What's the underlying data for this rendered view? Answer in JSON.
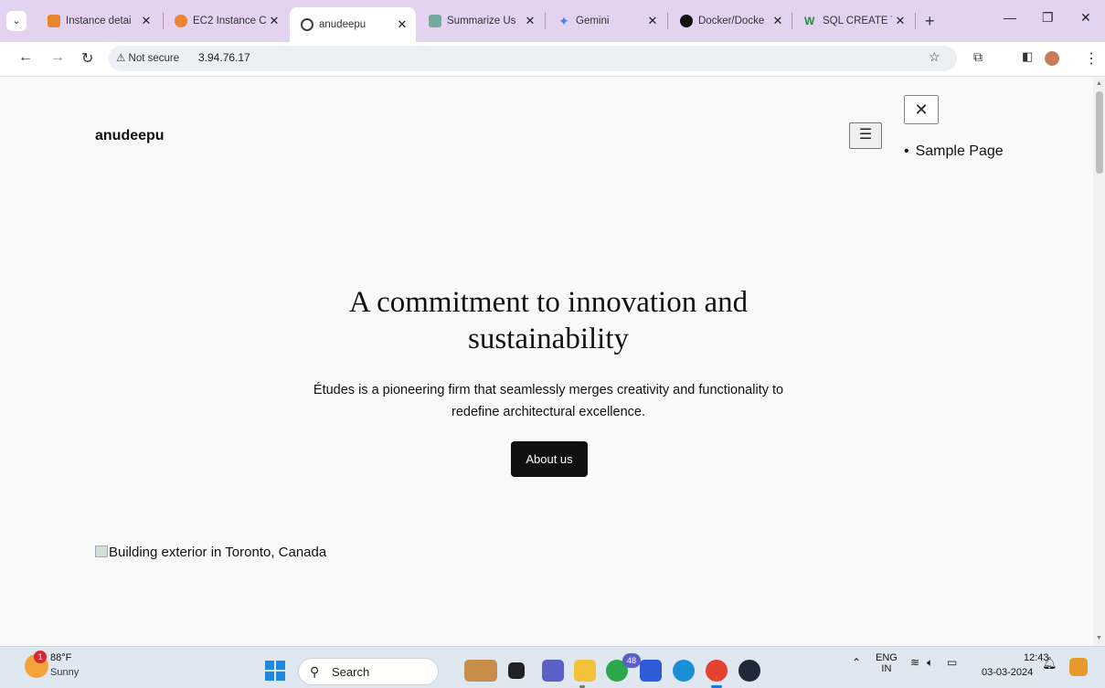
{
  "browser": {
    "tabs": [
      {
        "title": "Instance detai",
        "favicon_color": "#e8852e"
      },
      {
        "title": "EC2 Instance C",
        "favicon_color": "#e8852e"
      },
      {
        "title": "anudeepu",
        "favicon_color": "#3c4043"
      },
      {
        "title": "Summarize Us",
        "favicon_color": "#74aa9c"
      },
      {
        "title": "Gemini",
        "favicon_color": "#4e7cf6"
      },
      {
        "title": "Docker/Docke",
        "favicon_color": "#111111"
      },
      {
        "title": "SQL CREATE T",
        "favicon_color": "#1f8a3b"
      }
    ],
    "active_tab_index": 2,
    "security_label": "Not secure",
    "url": "3.94.76.17"
  },
  "site": {
    "title": "anudeepu",
    "menu_items": [
      "Sample Page"
    ],
    "hero_title": "A commitment to innovation and sustainability",
    "hero_description": "Études is a pioneering firm that seamlessly merges creativity and functionality to redefine architectural excellence.",
    "cta_label": "About us",
    "image_alt": "Building exterior in Toronto, Canada"
  },
  "taskbar": {
    "weather_temp": "88°F",
    "weather_condition": "Sunny",
    "weather_badge": "1",
    "search_label": "Search",
    "notification_count": "48",
    "language": "ENG",
    "region": "IN",
    "time": "12:43",
    "date": "03-03-2024"
  }
}
